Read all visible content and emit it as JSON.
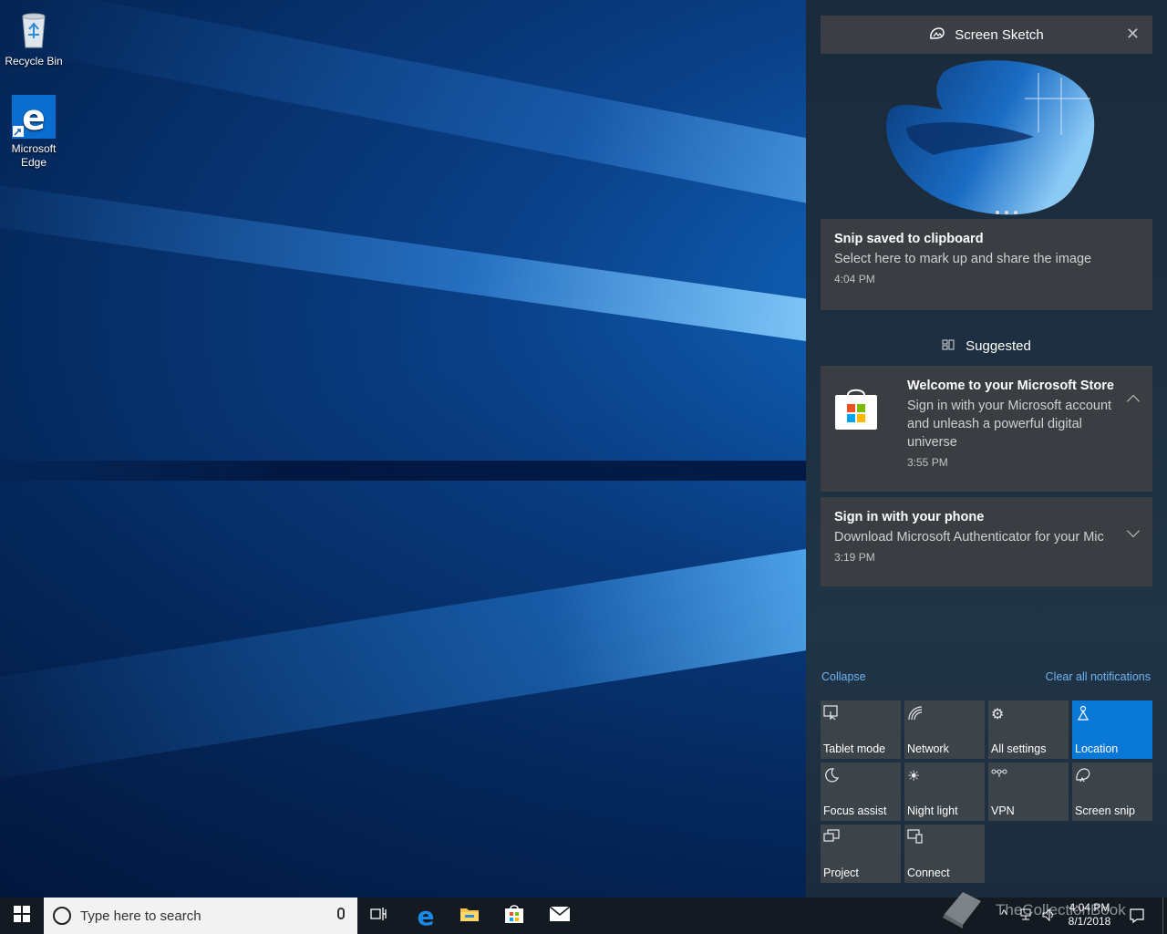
{
  "desktop": {
    "icons": [
      {
        "label": "Recycle Bin",
        "icon": "recycle-bin-icon"
      },
      {
        "label": "Microsoft Edge",
        "icon": "edge-icon"
      }
    ]
  },
  "action_center": {
    "screen_sketch": {
      "app_name": "Screen Sketch",
      "toast_title": "Snip saved to clipboard",
      "toast_body": "Select here to mark up and share the image",
      "toast_time": "4:04 PM"
    },
    "suggested": {
      "header": "Suggested",
      "store_title": "Welcome to your Microsoft Store",
      "store_body": "Sign in with your Microsoft account and unleash a powerful digital universe",
      "store_time": "3:55 PM",
      "phone_title": "Sign in with your phone",
      "phone_body": "Download Microsoft Authenticator for your Mic",
      "phone_time": "3:19 PM"
    },
    "collapse_label": "Collapse",
    "clear_label": "Clear all notifications",
    "quick_actions": [
      {
        "label": "Tablet mode",
        "icon": "tablet-mode-icon",
        "on": false
      },
      {
        "label": "Network",
        "icon": "network-icon",
        "on": false
      },
      {
        "label": "All settings",
        "icon": "gear-icon",
        "on": false
      },
      {
        "label": "Location",
        "icon": "location-icon",
        "on": true
      },
      {
        "label": "Focus assist",
        "icon": "moon-icon",
        "on": false
      },
      {
        "label": "Night light",
        "icon": "sun-icon",
        "on": false
      },
      {
        "label": "VPN",
        "icon": "vpn-icon",
        "on": false
      },
      {
        "label": "Screen snip",
        "icon": "screen-snip-icon",
        "on": false
      },
      {
        "label": "Project",
        "icon": "project-icon",
        "on": false
      },
      {
        "label": "Connect",
        "icon": "connect-icon",
        "on": false
      }
    ]
  },
  "taskbar": {
    "search_placeholder": "Type here to search",
    "clock_time": "4:04 PM",
    "clock_date": "8/1/2018",
    "watermark": "TheCollectionBook"
  },
  "colors": {
    "accent": "#0a78d7",
    "tile": "#3c4349",
    "toast": "#3a3d41",
    "link": "#6fb2f0"
  }
}
